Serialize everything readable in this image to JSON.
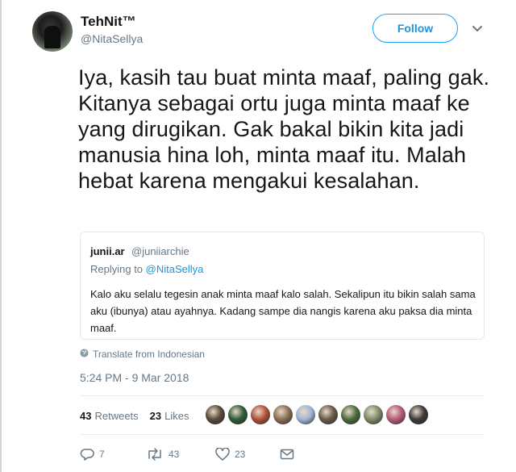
{
  "user": {
    "display_name": "TehNit™",
    "handle": "@NitaSellya",
    "follow_label": "Follow"
  },
  "tweet": {
    "text": "Iya, kasih tau buat minta maaf, paling gak. Kitanya sebagai ortu juga minta maaf ke yang dirugikan. Gak bakal bikin kita jadi manusia hina loh, minta maaf itu. Malah hebat karena mengakui kesalahan."
  },
  "quoted": {
    "name": "junii.ar",
    "handle": "@juniiarchie",
    "replying_prefix": "Replying to",
    "replying_to": "@NitaSellya",
    "text": "Kalo aku selalu tegesin anak minta maaf kalo salah. Sekalipun itu bikin salah sama aku (ibunya) atau ayahnya. Kadang sampe dia nangis karena aku paksa dia minta maaf."
  },
  "translate_label": "Translate from Indonesian",
  "timestamp": "5:24 PM - 9 Mar 2018",
  "stats": {
    "retweets_count": "43",
    "retweets_label": "Retweets",
    "likes_count": "23",
    "likes_label": "Likes"
  },
  "likers": [
    {
      "name": "liker-avatar-1",
      "color": "#5b4a3c"
    },
    {
      "name": "liker-avatar-2",
      "color": "#2f5d3a"
    },
    {
      "name": "liker-avatar-3",
      "color": "#b0523a"
    },
    {
      "name": "liker-avatar-4",
      "color": "#8a6f55"
    },
    {
      "name": "liker-avatar-5",
      "color": "#9fb7d4"
    },
    {
      "name": "liker-avatar-6",
      "color": "#6b5a4a"
    },
    {
      "name": "liker-avatar-7",
      "color": "#4e6b3e"
    },
    {
      "name": "liker-avatar-8",
      "color": "#7f8c6a"
    },
    {
      "name": "liker-avatar-9",
      "color": "#b85a7a"
    },
    {
      "name": "liker-avatar-10",
      "color": "#3b3b3b"
    }
  ],
  "actions": {
    "reply_count": "7",
    "retweet_count": "43",
    "like_count": "23"
  },
  "colors": {
    "accent": "#1da1f2",
    "muted": "#657786",
    "text": "#14171a",
    "border": "#e1e8ed"
  }
}
